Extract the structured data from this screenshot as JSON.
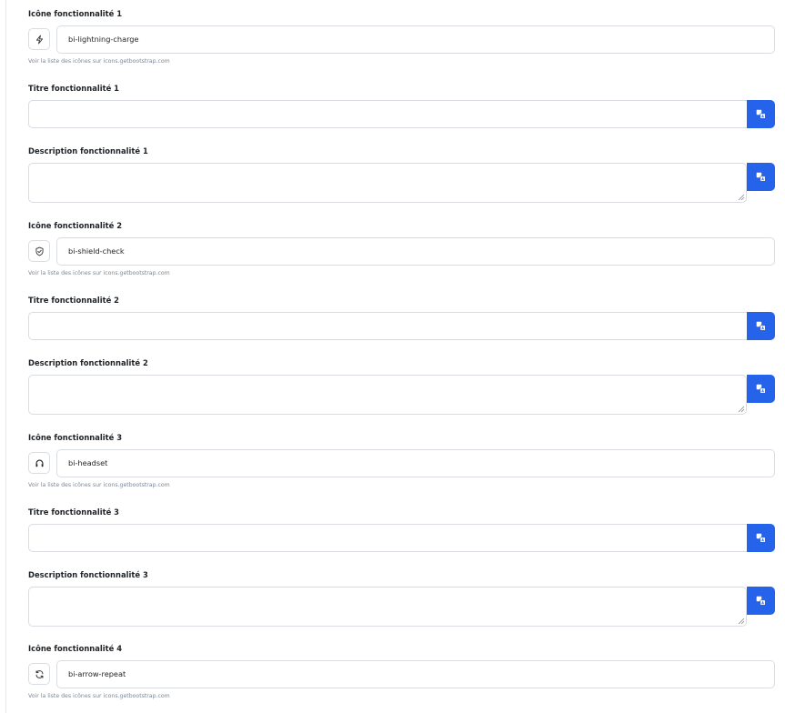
{
  "features": [
    {
      "icon_label": "Icône fonctionnalité 1",
      "icon_value": "bi-lightning-charge",
      "icon_name": "lightning-charge-icon",
      "help": "Voir la liste des icônes sur icons.getbootstrap.com",
      "title_label": "Titre fonctionnalité 1",
      "title_value": "",
      "desc_label": "Description fonctionnalité 1",
      "desc_value": ""
    },
    {
      "icon_label": "Icône fonctionnalité 2",
      "icon_value": "bi-shield-check",
      "icon_name": "shield-check-icon",
      "help": "Voir la liste des icônes sur icons.getbootstrap.com",
      "title_label": "Titre fonctionnalité 2",
      "title_value": "",
      "desc_label": "Description fonctionnalité 2",
      "desc_value": ""
    },
    {
      "icon_label": "Icône fonctionnalité 3",
      "icon_value": "bi-headset",
      "icon_name": "headset-icon",
      "help": "Voir la liste des icônes sur icons.getbootstrap.com",
      "title_label": "Titre fonctionnalité 3",
      "title_value": "",
      "desc_label": "Description fonctionnalité 3",
      "desc_value": ""
    },
    {
      "icon_label": "Icône fonctionnalité 4",
      "icon_value": "bi-arrow-repeat",
      "icon_name": "arrow-repeat-icon",
      "help": "Voir la liste des icônes sur icons.getbootstrap.com"
    }
  ],
  "colors": {
    "accent": "#2563eb",
    "border": "#d9dde2",
    "help_text": "#7b8794"
  },
  "icons": {
    "translate_button": "translate-icon"
  }
}
